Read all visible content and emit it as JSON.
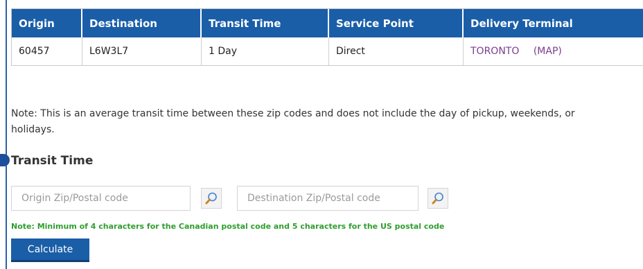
{
  "results": {
    "headers": {
      "origin": "Origin",
      "destination": "Destination",
      "transit_time": "Transit Time",
      "service_point": "Service Point",
      "delivery_terminal": "Delivery Terminal"
    },
    "row": {
      "origin": "60457",
      "destination": "L6W3L7",
      "transit_time": "1 Day",
      "service_point": "Direct",
      "terminal": "TORONTO",
      "map_link": "(MAP)"
    }
  },
  "note": {
    "line1": "Note: This is an average transit time between these zip codes and does not include the day of pickup, weekends, or",
    "line2": "holidays."
  },
  "transit_form": {
    "title": "Transit Time",
    "origin_placeholder": "Origin Zip/Postal code",
    "destination_placeholder": "Destination Zip/Postal code",
    "hint": "Note: Minimum of 4 characters for the Canadian postal code and 5 characters for the US postal code",
    "calculate_label": "Calculate"
  },
  "colors": {
    "header_bg": "#1a5ea8",
    "link": "#7b3d8f",
    "hint": "#2e9e2e"
  },
  "icons": {
    "lookup": "magnifier-icon"
  }
}
